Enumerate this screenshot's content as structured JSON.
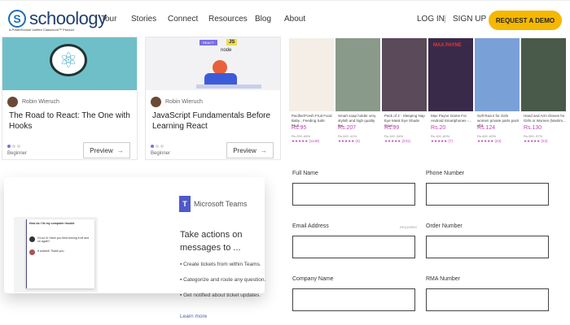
{
  "nav": {
    "logo": "schoology",
    "logo_letter": "S",
    "tagline": "A PowerSchool Unified Classroom™ Product",
    "links": [
      "Tour",
      "Stories",
      "Connect",
      "Resources",
      "Blog",
      "About"
    ],
    "login": "LOG IN",
    "sep": "|",
    "signup": "SIGN UP",
    "demo": "REQUEST A DEMO",
    "accent": "#f5b700"
  },
  "courses": [
    {
      "author": "Robin Wieruch",
      "title": "The Road to React: The One with Hooks",
      "level": "Beginner",
      "preview": "Preview"
    },
    {
      "author": "Robin Wieruch",
      "title": "JavaScript Fundamentals Before Learning React",
      "level": "Beginner",
      "preview": "Preview",
      "badges": [
        "REACT",
        "JS",
        "node"
      ]
    }
  ],
  "products": [
    {
      "name": "Pacifier/Fresh Fruit Food Baby , Feeding Safe Fruit...",
      "price": "Rs.95",
      "old": "Rs.299 -68%",
      "rating": "(1148)"
    },
    {
      "name": "Smart soap holder very stylish and high quality lea...",
      "price": "Rs.207",
      "old": "Rs.349 -41%",
      "rating": "(4)"
    },
    {
      "name": "Pack of 2 - Sleeping Nap Eye Mask Eye Shade Cove...",
      "price": "Rs.99",
      "old": "Rs.149 -34%",
      "rating": "(231)"
    },
    {
      "name": "Max Payne Game For Android Smartphones -...",
      "price": "Rs.20",
      "old": "Rs.100 -80%",
      "rating": "(7)"
    },
    {
      "name": "Soft Razor for Girls women private parts pack of 6",
      "price": "Rs.124",
      "old": "Rs.400 -69%",
      "rating": "(23)"
    },
    {
      "name": "Hand and Arm Gloves for Girls or Women (Muslim...",
      "price": "Rs.130",
      "old": "Rs.300 -57%",
      "rating": "(23)"
    }
  ],
  "product_poster": "MAX PAYNE",
  "teams": {
    "brand": "Microsoft Teams",
    "heading": "Take actions on messages to ...",
    "bullets": [
      "Create tickets from within Teams.",
      "Categorize and route any question.",
      "Get notified about ticket updates."
    ],
    "learn_more": "Learn more",
    "chat_title": "How do I fix my computer trouble",
    "msg1": "I'm so ill. Have you tried turning it off and on again?",
    "msg2": "It worked! Thank you."
  },
  "form": {
    "full_name": "Full Name",
    "phone": "Phone Number",
    "email": "Email Address",
    "required": "REQUIRED",
    "order": "Order Number",
    "company": "Company Name",
    "rma": "RMA Number"
  }
}
